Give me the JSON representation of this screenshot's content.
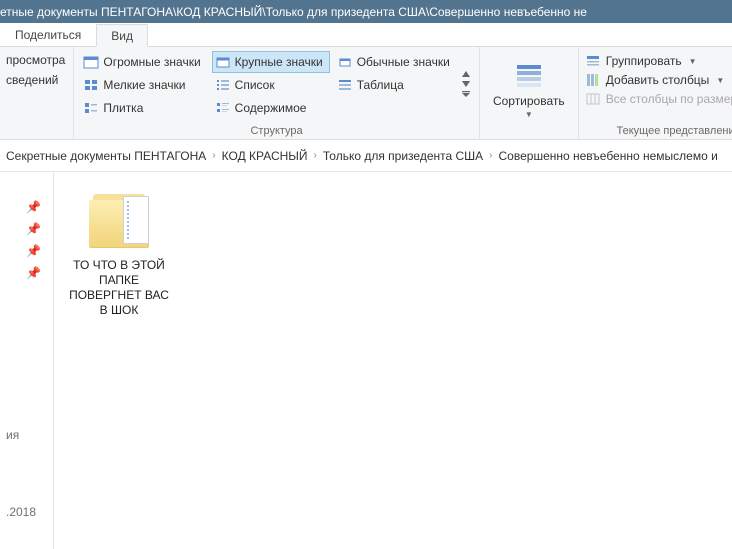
{
  "titlebar": {
    "path": "етные документы ПЕНТАГОНА\\КОД КРАСНЫЙ\\Только для призедента США\\Совершенно невъебенно не"
  },
  "tabs": {
    "share": "Поделиться",
    "view": "Вид"
  },
  "ribbon": {
    "panes": {
      "row1": "просмотра",
      "row2": "сведений"
    },
    "layout": {
      "huge": "Огромные значки",
      "large": "Крупные значки",
      "normal": "Обычные значки",
      "small": "Мелкие значки",
      "list": "Список",
      "table": "Таблица",
      "tile": "Плитка",
      "details": "Содержимое",
      "group_label": "Структура"
    },
    "sort": {
      "label": "Сортировать"
    },
    "view": {
      "group_by": "Группировать",
      "add_columns": "Добавить столбцы",
      "autofit": "Все столбцы по размеру соде",
      "group_label": "Текущее представление"
    }
  },
  "breadcrumb": {
    "items": [
      "Секретные документы ПЕНТАГОНА",
      "КОД КРАСНЫЙ",
      "Только для призедента США",
      "Совершенно невъебенно немыслемо и"
    ]
  },
  "nav": {
    "line1": "ия",
    "line2": ".2018"
  },
  "folder": {
    "name": "ТО ЧТО В ЭТОЙ ПАПКЕ ПОВЕРГНЕТ ВАС В ШОК"
  }
}
